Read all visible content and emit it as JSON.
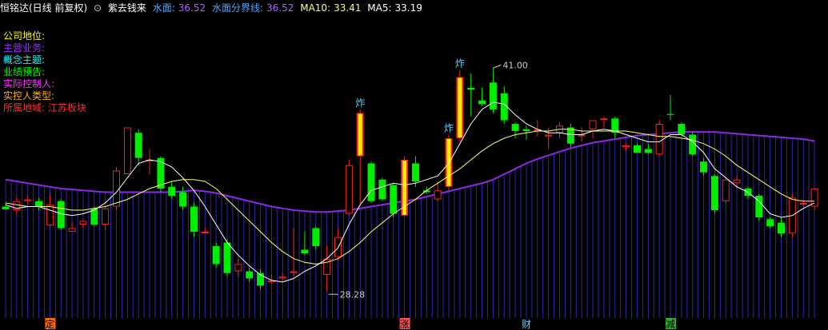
{
  "header": {
    "stock_title": "恒铭达(日线 前复权)",
    "indicator_name": "紫去钱来",
    "items": [
      {
        "label": "水面:",
        "value": "36.52",
        "label_color": "#4aa8ff",
        "value_color": "#b060ff"
      },
      {
        "label": "水面分界线:",
        "value": "36.52",
        "label_color": "#4aa8ff",
        "value_color": "#b060ff"
      },
      {
        "label": "MA10:",
        "value": "33.41",
        "label_color": "#ffff66",
        "value_color": "#ffff66"
      },
      {
        "label": "MA5:",
        "value": "33.19",
        "label_color": "#ffffff",
        "value_color": "#ffffff"
      }
    ]
  },
  "info_panel": [
    {
      "label": "公司地位:",
      "color": "#ffff00"
    },
    {
      "label": "主营业务:",
      "color": "#9b30ff"
    },
    {
      "label": "概念主题:",
      "color": "#00ffff"
    },
    {
      "label": "业绩预告:",
      "color": "#00ff00"
    },
    {
      "label": "实际控制人:",
      "color": "#ff33ff"
    },
    {
      "label": "实控人类型:",
      "color": "#ffaa00"
    },
    {
      "label": "所属地域: 江苏板块",
      "color": "#ff3030"
    }
  ],
  "colors": {
    "up": "#ff2020",
    "down": "#00ee00",
    "special": "#ffee00",
    "water": "#8a2be2",
    "water_bars": "#2a2aaa",
    "ma5": "#ffffff",
    "ma10": "#ffff66"
  },
  "chart_data": {
    "type": "candlestick",
    "ylim": [
      26.8,
      43.6
    ],
    "max_label": "41.00",
    "min_label": "28.28",
    "candles": [
      {
        "o": 33.0,
        "h": 33.2,
        "l": 32.8,
        "c": 32.85,
        "t": "down"
      },
      {
        "o": 32.8,
        "h": 33.5,
        "l": 32.6,
        "c": 33.3,
        "t": "up"
      },
      {
        "o": 33.4,
        "h": 33.6,
        "l": 33.1,
        "c": 33.3,
        "t": "up"
      },
      {
        "o": 33.3,
        "h": 33.5,
        "l": 32.8,
        "c": 33.0,
        "t": "down"
      },
      {
        "o": 33.1,
        "h": 33.7,
        "l": 31.9,
        "c": 31.95,
        "t": "up"
      },
      {
        "o": 33.3,
        "h": 33.4,
        "l": 31.7,
        "c": 31.8,
        "t": "down"
      },
      {
        "o": 31.8,
        "h": 32.1,
        "l": 31.6,
        "c": 31.6,
        "t": "up"
      },
      {
        "o": 32.2,
        "h": 32.3,
        "l": 31.8,
        "c": 32.0,
        "t": "up"
      },
      {
        "o": 32.9,
        "h": 33.0,
        "l": 31.9,
        "c": 32.0,
        "t": "down"
      },
      {
        "o": 32.0,
        "h": 33.0,
        "l": 31.7,
        "c": 32.9,
        "t": "up"
      },
      {
        "o": 33.0,
        "h": 35.2,
        "l": 32.8,
        "c": 35.0,
        "t": "up"
      },
      {
        "o": 34.8,
        "h": 37.4,
        "l": 34.8,
        "c": 37.4,
        "t": "up"
      },
      {
        "o": 37.1,
        "h": 37.3,
        "l": 35.3,
        "c": 35.7,
        "t": "down"
      },
      {
        "o": 35.6,
        "h": 36.2,
        "l": 34.8,
        "c": 35.6,
        "t": "up"
      },
      {
        "o": 35.7,
        "h": 35.8,
        "l": 33.8,
        "c": 34.0,
        "t": "down"
      },
      {
        "o": 34.1,
        "h": 34.4,
        "l": 33.4,
        "c": 33.6,
        "t": "down"
      },
      {
        "o": 33.8,
        "h": 34.1,
        "l": 32.8,
        "c": 33.0,
        "t": "down"
      },
      {
        "o": 33.0,
        "h": 33.2,
        "l": 31.3,
        "c": 31.6,
        "t": "down"
      },
      {
        "o": 31.6,
        "h": 31.8,
        "l": 31.5,
        "c": 31.6,
        "t": "up"
      },
      {
        "o": 30.8,
        "h": 31.0,
        "l": 29.6,
        "c": 29.8,
        "t": "down"
      },
      {
        "o": 31.0,
        "h": 31.2,
        "l": 29.1,
        "c": 29.3,
        "t": "down"
      },
      {
        "o": 29.8,
        "h": 30.1,
        "l": 29.1,
        "c": 29.4,
        "t": "up"
      },
      {
        "o": 29.4,
        "h": 29.6,
        "l": 28.8,
        "c": 29.0,
        "t": "down"
      },
      {
        "o": 29.3,
        "h": 29.5,
        "l": 28.4,
        "c": 28.6,
        "t": "down"
      },
      {
        "o": 28.9,
        "h": 29.2,
        "l": 28.7,
        "c": 28.8,
        "t": "up"
      },
      {
        "o": 29.1,
        "h": 29.3,
        "l": 28.9,
        "c": 29.0,
        "t": "up"
      },
      {
        "o": 29.3,
        "h": 31.8,
        "l": 29.1,
        "c": 29.4,
        "t": "up"
      },
      {
        "o": 30.4,
        "h": 31.6,
        "l": 30.3,
        "c": 30.6,
        "t": "down"
      },
      {
        "o": 31.8,
        "h": 31.9,
        "l": 30.6,
        "c": 30.8,
        "t": "down"
      },
      {
        "o": 29.2,
        "h": 30.8,
        "l": 28.3,
        "c": 30.1,
        "t": "up"
      },
      {
        "o": 30.2,
        "h": 31.8,
        "l": 30.0,
        "c": 31.3,
        "t": "up"
      },
      {
        "o": 32.6,
        "h": 35.6,
        "l": 32.5,
        "c": 35.3,
        "t": "up"
      },
      {
        "o": 38.2,
        "h": 38.4,
        "l": 33.0,
        "c": 35.8,
        "t": "special"
      },
      {
        "o": 35.4,
        "h": 35.5,
        "l": 33.2,
        "c": 33.3,
        "t": "down"
      },
      {
        "o": 34.5,
        "h": 34.6,
        "l": 33.3,
        "c": 33.4,
        "t": "down"
      },
      {
        "o": 34.2,
        "h": 34.3,
        "l": 32.4,
        "c": 32.6,
        "t": "down"
      },
      {
        "o": 32.5,
        "h": 35.8,
        "l": 32.5,
        "c": 35.6,
        "t": "special"
      },
      {
        "o": 35.4,
        "h": 35.8,
        "l": 34.1,
        "c": 34.4,
        "t": "down"
      },
      {
        "o": 33.9,
        "h": 34.1,
        "l": 33.7,
        "c": 33.8,
        "t": "down"
      },
      {
        "o": 33.4,
        "h": 34.4,
        "l": 33.3,
        "c": 33.9,
        "t": "up"
      },
      {
        "o": 34.1,
        "h": 37.0,
        "l": 33.9,
        "c": 36.8,
        "t": "special"
      },
      {
        "o": 36.8,
        "h": 40.6,
        "l": 36.6,
        "c": 40.2,
        "t": "special"
      },
      {
        "o": 39.6,
        "h": 40.4,
        "l": 38.0,
        "c": 39.5,
        "t": "down"
      },
      {
        "o": 38.9,
        "h": 39.6,
        "l": 38.6,
        "c": 38.7,
        "t": "down"
      },
      {
        "o": 38.4,
        "h": 40.7,
        "l": 38.2,
        "c": 39.9,
        "t": "down"
      },
      {
        "o": 39.3,
        "h": 39.7,
        "l": 37.6,
        "c": 37.8,
        "t": "down"
      },
      {
        "o": 37.6,
        "h": 37.7,
        "l": 36.8,
        "c": 37.2,
        "t": "down"
      },
      {
        "o": 37.3,
        "h": 37.5,
        "l": 36.7,
        "c": 37.2,
        "t": "down"
      },
      {
        "o": 37.3,
        "h": 37.8,
        "l": 36.9,
        "c": 37.2,
        "t": "up"
      },
      {
        "o": 36.9,
        "h": 37.4,
        "l": 36.2,
        "c": 37.0,
        "t": "up"
      },
      {
        "o": 37.1,
        "h": 37.7,
        "l": 36.8,
        "c": 37.5,
        "t": "up"
      },
      {
        "o": 37.4,
        "h": 37.6,
        "l": 36.3,
        "c": 36.5,
        "t": "down"
      },
      {
        "o": 37.0,
        "h": 37.4,
        "l": 36.6,
        "c": 37.0,
        "t": "up"
      },
      {
        "o": 37.3,
        "h": 37.4,
        "l": 36.8,
        "c": 37.8,
        "t": "up"
      },
      {
        "o": 37.9,
        "h": 38.0,
        "l": 37.4,
        "c": 37.9,
        "t": "up"
      },
      {
        "o": 37.9,
        "h": 38.0,
        "l": 36.8,
        "c": 37.1,
        "t": "down"
      },
      {
        "o": 36.3,
        "h": 36.5,
        "l": 36.1,
        "c": 36.4,
        "t": "up"
      },
      {
        "o": 36.4,
        "h": 36.5,
        "l": 36.0,
        "c": 36.0,
        "t": "down"
      },
      {
        "o": 36.2,
        "h": 36.5,
        "l": 35.9,
        "c": 36.0,
        "t": "down"
      },
      {
        "o": 35.9,
        "h": 37.8,
        "l": 35.8,
        "c": 37.6,
        "t": "up"
      },
      {
        "o": 38.1,
        "h": 39.2,
        "l": 37.8,
        "c": 38.15,
        "t": "down"
      },
      {
        "o": 37.6,
        "h": 37.7,
        "l": 36.9,
        "c": 37.0,
        "t": "down"
      },
      {
        "o": 37.0,
        "h": 37.1,
        "l": 35.8,
        "c": 35.9,
        "t": "down"
      },
      {
        "o": 35.5,
        "h": 35.7,
        "l": 34.7,
        "c": 34.9,
        "t": "down"
      },
      {
        "o": 34.7,
        "h": 34.8,
        "l": 32.6,
        "c": 32.8,
        "t": "down"
      },
      {
        "o": 33.3,
        "h": 34.6,
        "l": 33.2,
        "c": 34.5,
        "t": "up"
      },
      {
        "o": 34.5,
        "h": 34.7,
        "l": 34.0,
        "c": 34.3,
        "t": "up"
      },
      {
        "o": 34.0,
        "h": 34.1,
        "l": 33.4,
        "c": 33.6,
        "t": "down"
      },
      {
        "o": 33.6,
        "h": 33.7,
        "l": 32.2,
        "c": 32.4,
        "t": "down"
      },
      {
        "o": 32.3,
        "h": 32.4,
        "l": 31.8,
        "c": 31.9,
        "t": "down"
      },
      {
        "o": 32.1,
        "h": 32.4,
        "l": 31.3,
        "c": 31.5,
        "t": "down"
      },
      {
        "o": 31.5,
        "h": 33.7,
        "l": 31.3,
        "c": 33.5,
        "t": "up"
      },
      {
        "o": 33.2,
        "h": 33.4,
        "l": 33.0,
        "c": 33.2,
        "t": "up"
      },
      {
        "o": 33.0,
        "h": 34.0,
        "l": 32.8,
        "c": 34.0,
        "t": "up"
      }
    ],
    "ma5": [
      33.1,
      32.9,
      33.0,
      33.0,
      32.8,
      32.6,
      32.5,
      32.6,
      32.8,
      33.2,
      33.8,
      34.6,
      35.4,
      35.6,
      35.5,
      35.2,
      34.6,
      33.9,
      33.0,
      32.0,
      31.0,
      30.3,
      29.7,
      29.2,
      28.9,
      28.8,
      29.0,
      29.4,
      29.7,
      30.1,
      30.7,
      32.0,
      33.1,
      33.9,
      34.1,
      34.3,
      34.2,
      34.3,
      34.5,
      34.7,
      35.4,
      36.5,
      37.6,
      38.4,
      38.8,
      38.7,
      38.1,
      37.6,
      37.3,
      37.1,
      37.1,
      37.0,
      37.0,
      37.2,
      37.3,
      37.2,
      37.0,
      36.8,
      36.6,
      36.6,
      37.0,
      37.0,
      36.6,
      36.0,
      35.1,
      34.6,
      34.1,
      33.8,
      33.3,
      32.6,
      32.4,
      32.5,
      32.9,
      33.2
    ],
    "ma10": [
      33.2,
      33.1,
      33.0,
      33.0,
      33.0,
      32.9,
      32.8,
      32.8,
      32.9,
      33.0,
      33.2,
      33.4,
      33.7,
      34.0,
      34.2,
      34.4,
      34.5,
      34.5,
      34.4,
      34.0,
      33.4,
      32.8,
      32.2,
      31.6,
      31.0,
      30.5,
      30.1,
      29.9,
      29.8,
      29.9,
      30.1,
      30.5,
      31.0,
      31.6,
      32.1,
      32.6,
      33.0,
      33.4,
      33.9,
      34.3,
      34.7,
      35.1,
      35.6,
      36.1,
      36.5,
      36.8,
      37.0,
      37.1,
      37.2,
      37.2,
      37.3,
      37.3,
      37.2,
      37.2,
      37.2,
      37.2,
      37.2,
      37.1,
      37.0,
      36.9,
      36.9,
      36.8,
      36.7,
      36.5,
      36.2,
      35.8,
      35.3,
      34.9,
      34.5,
      34.1,
      33.7,
      33.4,
      33.3,
      33.3
    ],
    "water_level": [
      34.5,
      34.4,
      34.3,
      34.2,
      34.1,
      34.0,
      33.95,
      33.9,
      33.85,
      33.8,
      33.8,
      33.8,
      33.8,
      33.8,
      33.8,
      33.8,
      33.85,
      33.9,
      33.85,
      33.75,
      33.6,
      33.45,
      33.3,
      33.15,
      33.0,
      32.9,
      32.8,
      32.75,
      32.7,
      32.7,
      32.75,
      32.8,
      32.9,
      33.0,
      33.1,
      33.2,
      33.3,
      33.4,
      33.55,
      33.7,
      33.85,
      34.0,
      34.15,
      34.3,
      34.5,
      34.8,
      35.1,
      35.4,
      35.65,
      35.85,
      36.05,
      36.25,
      36.4,
      36.55,
      36.65,
      36.75,
      36.85,
      36.95,
      37.0,
      37.05,
      37.1,
      37.15,
      37.15,
      37.15,
      37.15,
      37.1,
      37.05,
      37.0,
      36.95,
      36.9,
      36.85,
      36.8,
      36.75,
      36.65
    ],
    "signals": [
      {
        "index": 32,
        "text": "炸"
      },
      {
        "index": 40,
        "text": "炸"
      },
      {
        "index": 41,
        "text": "炸"
      }
    ],
    "bottom_markers": [
      {
        "index": 4,
        "text": "定",
        "bg": "#ff6a00",
        "fg": "#000000"
      },
      {
        "index": 36,
        "text": "涨",
        "bg": "#ff5555",
        "fg": "#000000"
      },
      {
        "index": 47,
        "text": "财",
        "bg": "#000000",
        "fg": "#66ccff"
      },
      {
        "index": 60,
        "text": "减",
        "bg": "#33aa33",
        "fg": "#000000"
      }
    ]
  }
}
